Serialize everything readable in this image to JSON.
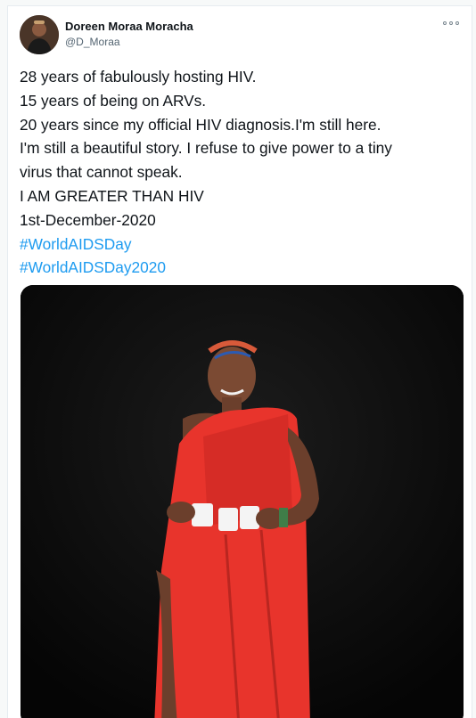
{
  "tweet": {
    "author": {
      "name": "Doreen Moraa Moracha",
      "handle": "@D_Moraa"
    },
    "lines": [
      "28 years of fabulously hosting HIV.",
      "15 years of being on ARVs.",
      "20 years since my official HIV diagnosis.I'm still here.",
      "I'm still a beautiful story. I refuse to give power to a tiny",
      "virus that cannot speak.",
      "I AM GREATER THAN HIV",
      "1st-December-2020"
    ],
    "hashtags": [
      "#WorldAIDSDay",
      "#WorldAIDSDay2020"
    ],
    "media": {
      "icon": "photo",
      "description_colors": {
        "background": "#0b0b0b",
        "dress": "#e8342c"
      }
    },
    "icons": {
      "more": "more-horizontal-icon"
    }
  }
}
